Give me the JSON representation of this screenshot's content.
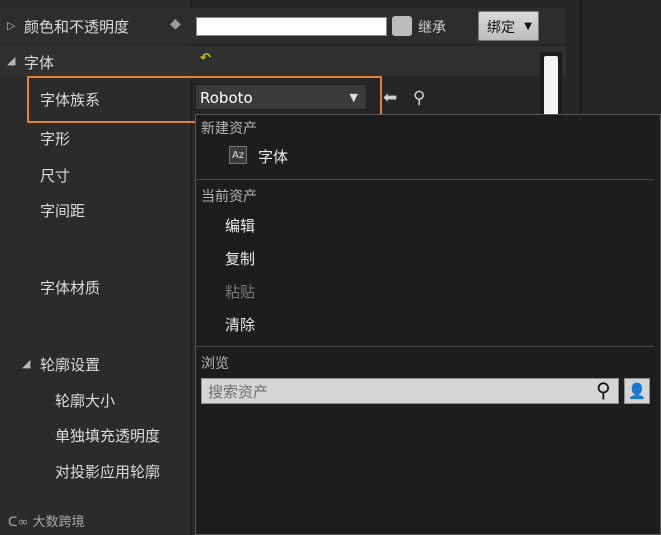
{
  "properties": {
    "color_opacity": {
      "label": "颜色和不透明度",
      "inherit_label": "继承",
      "bind_label": "绑定",
      "swatch_color": "#ffffff"
    },
    "font": {
      "label": "字体",
      "family_label": "字体族系",
      "family_value": "Roboto",
      "typeface_label": "字形",
      "size_label": "尺寸",
      "letter_spacing_label": "字间距",
      "material_label": "字体材质",
      "outline": {
        "label": "轮廓设置",
        "size_label": "轮廓大小",
        "separate_fill_alpha_label": "单独填充透明度",
        "apply_to_shadows_label": "对投影应用轮廓"
      }
    }
  },
  "asset_menu": {
    "new_asset_header": "新建资产",
    "new_font_label": "字体",
    "current_asset_header": "当前资产",
    "edit_label": "编辑",
    "copy_label": "复制",
    "paste_label": "粘贴",
    "clear_label": "清除",
    "browse_header": "浏览",
    "search_placeholder": "搜索资产"
  },
  "watermark": {
    "text": "大数跨境"
  },
  "colors": {
    "highlight": "#e8822a",
    "reset_arrow": "#d4c000"
  }
}
